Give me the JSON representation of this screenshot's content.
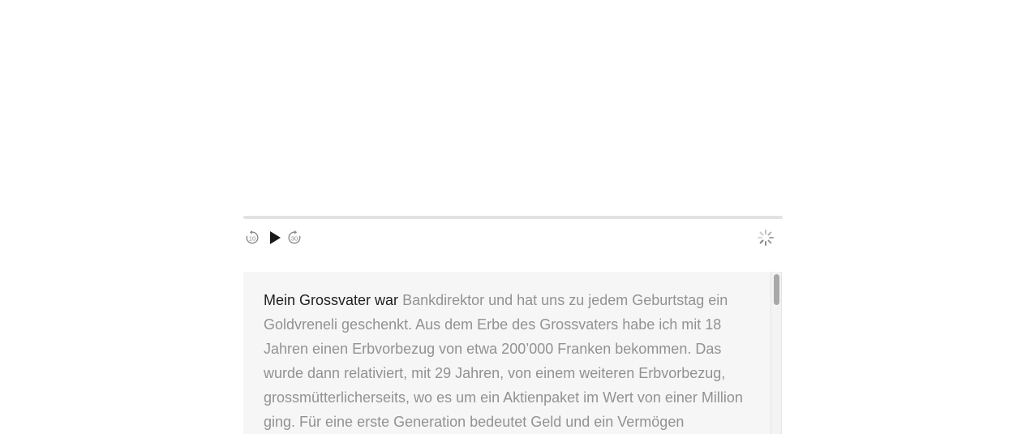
{
  "player": {
    "progress": 0.0,
    "controls": {
      "rewind_seconds": "10",
      "forward_seconds": "30",
      "rewind_icon": "rewind-10-icon",
      "play_icon": "play-icon",
      "forward_icon": "forward-30-icon",
      "loading_icon": "loading-spinner-icon"
    }
  },
  "transcript": {
    "spoken_text": "Mein Grossvater war",
    "remaining_text": "Bankdirektor und hat uns zu jedem Geburtstag ein Goldvreneli geschenkt. Aus dem Erbe des Grossvaters habe ich mit 18 Jahren einen Erbvorbezug von etwa 200’000 Franken bekommen. Das wurde dann relativiert, mit 29 Jahren, von einem weiteren Erbvorbezug, grossmütterlicherseits, wo es um ein Aktienpaket im Wert von einer Million ging. Für eine erste Generation bedeutet Geld und ein Vermögen"
  },
  "colors": {
    "spoken": "#1f1f1f",
    "unspoken": "#929292",
    "panel_bg": "#f6f6f6",
    "track": "#e2e2e2"
  }
}
